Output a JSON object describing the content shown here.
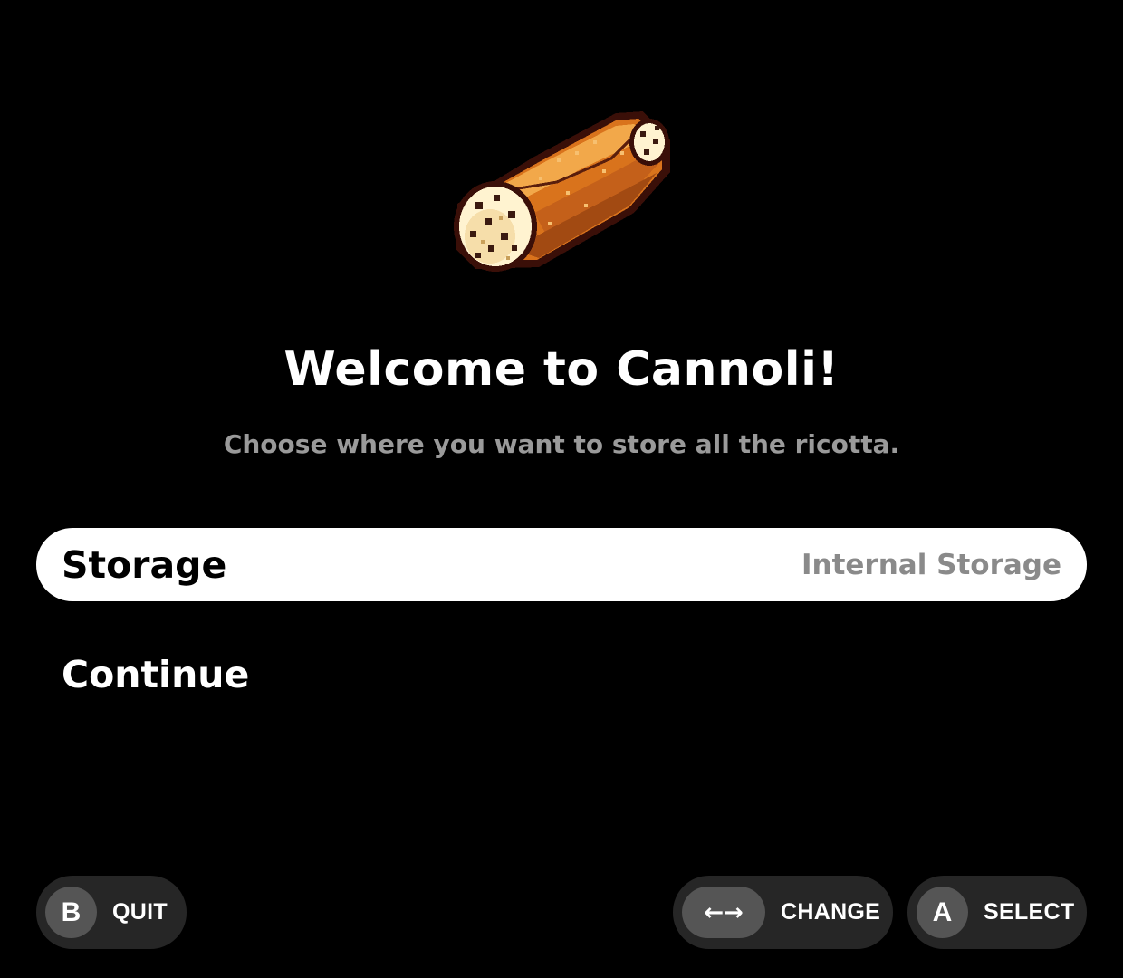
{
  "header": {
    "logo_icon": "cannoli-pixel-art-icon",
    "title": "Welcome to Cannoli!",
    "subtitle": "Choose where you want to store all the ricotta."
  },
  "menu": {
    "items": [
      {
        "label": "Storage",
        "value": "Internal Storage",
        "selected": true
      },
      {
        "label": "Continue",
        "selected": false
      }
    ]
  },
  "footer": {
    "quit": {
      "key": "B",
      "label": "QUIT"
    },
    "change": {
      "key": "←→",
      "label": "CHANGE"
    },
    "select": {
      "key": "A",
      "label": "SELECT"
    }
  },
  "colors": {
    "background": "#000000",
    "selected_row": "#ffffff",
    "subtitle_text": "#9a9a9a",
    "value_text": "#8a8a8a",
    "hint_pill": "#262626",
    "key_circle": "#555555",
    "accent_orange": "#e8902a"
  }
}
